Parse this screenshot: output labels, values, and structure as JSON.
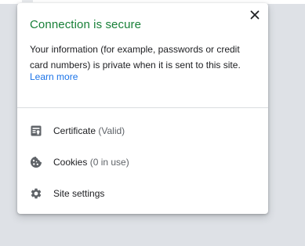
{
  "popup": {
    "title": "Connection is secure",
    "description": "Your information (for example, passwords or credit card numbers) is private when it is sent to this site.",
    "learn_more": "Learn more",
    "close_icon": "close-icon",
    "items": [
      {
        "label": "Certificate",
        "detail": " (Valid)",
        "icon": "certificate-icon"
      },
      {
        "label": "Cookies",
        "detail": " (0 in use)",
        "icon": "cookie-icon"
      },
      {
        "label": "Site settings",
        "detail": "",
        "icon": "gear-icon"
      }
    ]
  },
  "colors": {
    "title_green": "#188038",
    "link_blue": "#1a73e8",
    "icon_gray": "#5f6368",
    "backdrop": "#dee1e6"
  }
}
